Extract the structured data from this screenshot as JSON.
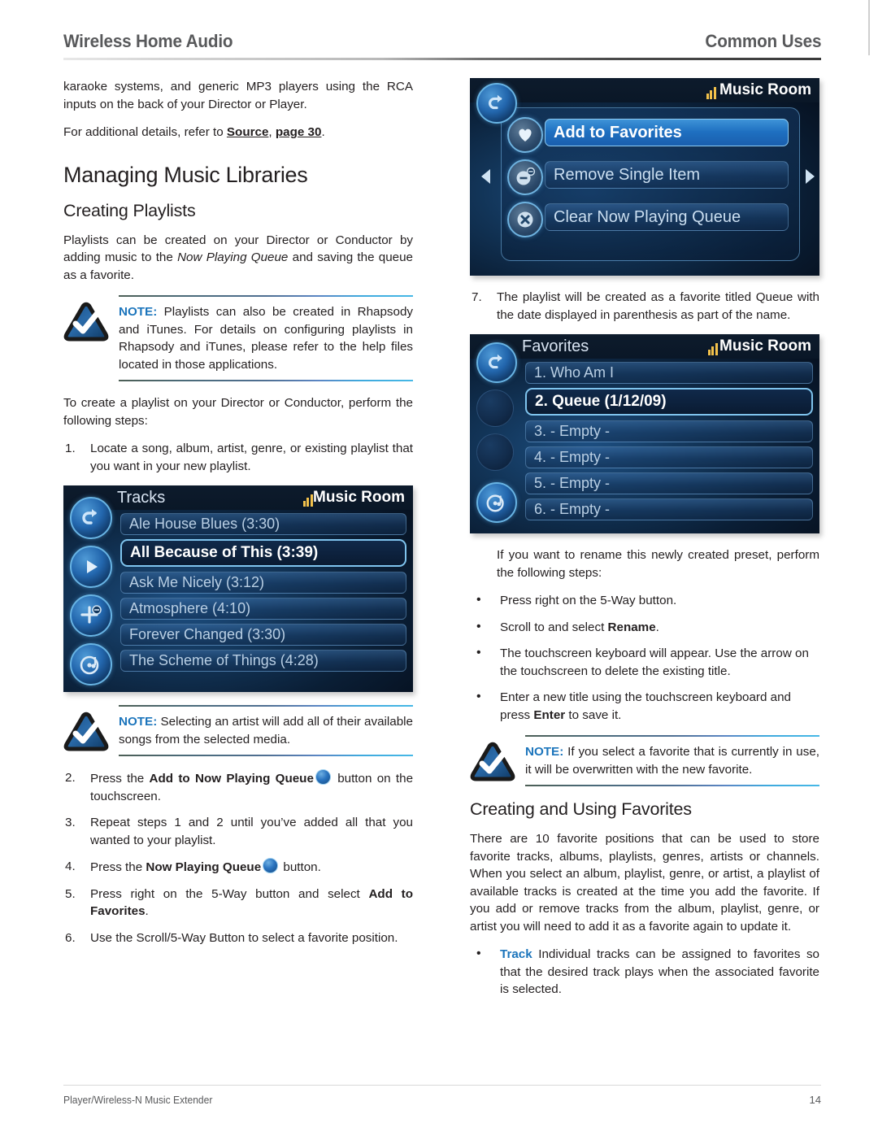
{
  "header": {
    "left_title": "Wireless Home Audio",
    "right_title": "Common Uses"
  },
  "footer": {
    "left": "Player/Wireless-N Music Extender",
    "page_number": "14"
  },
  "left_column": {
    "intro_paragraph": "karaoke systems, and generic MP3 players using the RCA inputs on the back of your Director or Player.",
    "reference_prefix": "For additional details, refer to ",
    "reference_link_1": "Source",
    "reference_separator": ", ",
    "reference_link_2": "page 30",
    "reference_suffix": ".",
    "section_heading": "Managing Music Libraries",
    "subsection_heading": "Creating Playlists",
    "playlists_para_part1": "Playlists can be created on your Director or Conductor by adding music to the ",
    "playlists_para_italic": "Now Playing Queue",
    "playlists_para_part2": " and saving the queue as a favorite.",
    "note1_label": "NOTE:",
    "note1_text": " Playlists can also be created in Rhapsody and iTunes. For details on configuring playlists in Rhapsody and iTunes, please refer to the help files located in those applications.",
    "create_para": "To create a playlist on your Director or Conductor, perform the following steps:",
    "step1_num": "1.",
    "step1_text": "Locate a song, album, artist, genre, or existing playlist that you want in your new playlist.",
    "note2_label": "NOTE:",
    "note2_text": " Selecting an artist will add all of their available songs from the selected media.",
    "step2_num": "2.",
    "step2_prefix": "Press the ",
    "step2_bold": "Add to Now Playing Queue",
    "step2_suffix": " button on the touchscreen.",
    "step3_num": "3.",
    "step3_text": "Repeat steps 1 and 2 until you’ve added all that you wanted to your playlist.",
    "step4_num": "4.",
    "step4_prefix": "Press the ",
    "step4_bold": "Now Playing Queue",
    "step4_suffix": " button.",
    "step5_num": "5.",
    "step5_prefix": "Press right on the 5-Way button and select ",
    "step5_bold": "Add to Favorites",
    "step5_suffix": ".",
    "step6_num": "6.",
    "step6_text": "Use the Scroll/5-Way Button to select a favorite position."
  },
  "right_column": {
    "step7_num": "7.",
    "step7_text": "The playlist will be created as a favorite titled Queue with the date displayed in parenthesis as part of the name.",
    "rename_intro": "If you want to rename this newly created preset, perform the following steps:",
    "bullets": [
      {
        "text": "Press right on the 5-Way button."
      },
      {
        "prefix": "Scroll to and select ",
        "bold": "Rename",
        "suffix": "."
      },
      {
        "text": "The touchscreen keyboard will appear. Use the arrow on the touchscreen to delete the existing title."
      },
      {
        "prefix": "Enter a new title using the touchscreen keyboard and press ",
        "bold": "Enter",
        "suffix": " to save it."
      }
    ],
    "note3_label": "NOTE:",
    "note3_text": " If you select a favorite that is currently in use, it will be overwritten with the new favorite.",
    "favorites_heading": "Creating and Using Favorites",
    "favorites_para": "There are 10 favorite positions that can be used to store favorite tracks, albums, playlists, genres, artists or channels. When you select an album, playlist, genre, or artist, a playlist of available tracks is created at the time you add the favorite. If you add or remove tracks from the album, playlist, genre, or artist you will need to add it as a favorite again to update it.",
    "track_bullet_keyword": "Track",
    "track_bullet_text": " Individual tracks can be assigned to favorites so that the desired track plays when the associated favorite is selected."
  },
  "screens": {
    "context_menu": {
      "room_label": "Music Room",
      "items": [
        {
          "label": "Add to Favorites",
          "icon": "heart-icon",
          "state": "highlighted"
        },
        {
          "label": "Remove Single Item",
          "icon": "minus-circle-icon",
          "state": "normal"
        },
        {
          "label": "Clear Now Playing Queue",
          "icon": "x-circle-icon",
          "state": "normal"
        }
      ]
    },
    "tracks": {
      "title": "Tracks",
      "room_label": "Music Room",
      "items": [
        {
          "label": "Ale House Blues (3:30)",
          "state": "normal"
        },
        {
          "label": "All Because of This (3:39)",
          "state": "selected"
        },
        {
          "label": "Ask Me Nicely (3:12)",
          "state": "normal"
        },
        {
          "label": "Atmosphere (4:10)",
          "state": "normal"
        },
        {
          "label": "Forever Changed (3:30)",
          "state": "normal"
        },
        {
          "label": "The Scheme of Things (4:28)",
          "state": "normal"
        }
      ],
      "rail_icons": [
        "back-arrow-icon",
        "play-icon",
        "add-to-queue-icon",
        "now-playing-queue-icon"
      ]
    },
    "favorites": {
      "title": "Favorites",
      "room_label": "Music Room",
      "items": [
        {
          "label": "1. Who Am I",
          "state": "normal"
        },
        {
          "label": "2. Queue (1/12/09)",
          "state": "selected"
        },
        {
          "label": "3. - Empty -",
          "state": "normal"
        },
        {
          "label": "4. - Empty -",
          "state": "normal"
        },
        {
          "label": "5. - Empty -",
          "state": "normal"
        },
        {
          "label": "6. - Empty -",
          "state": "normal"
        }
      ],
      "rail_icons": [
        "back-arrow-icon",
        "now-playing-queue-icon"
      ]
    }
  },
  "colors": {
    "accent_blue": "#1c75bc",
    "header_gray": "#58595b",
    "body_black": "#231f20",
    "signal_gold": "#f2c14b"
  }
}
